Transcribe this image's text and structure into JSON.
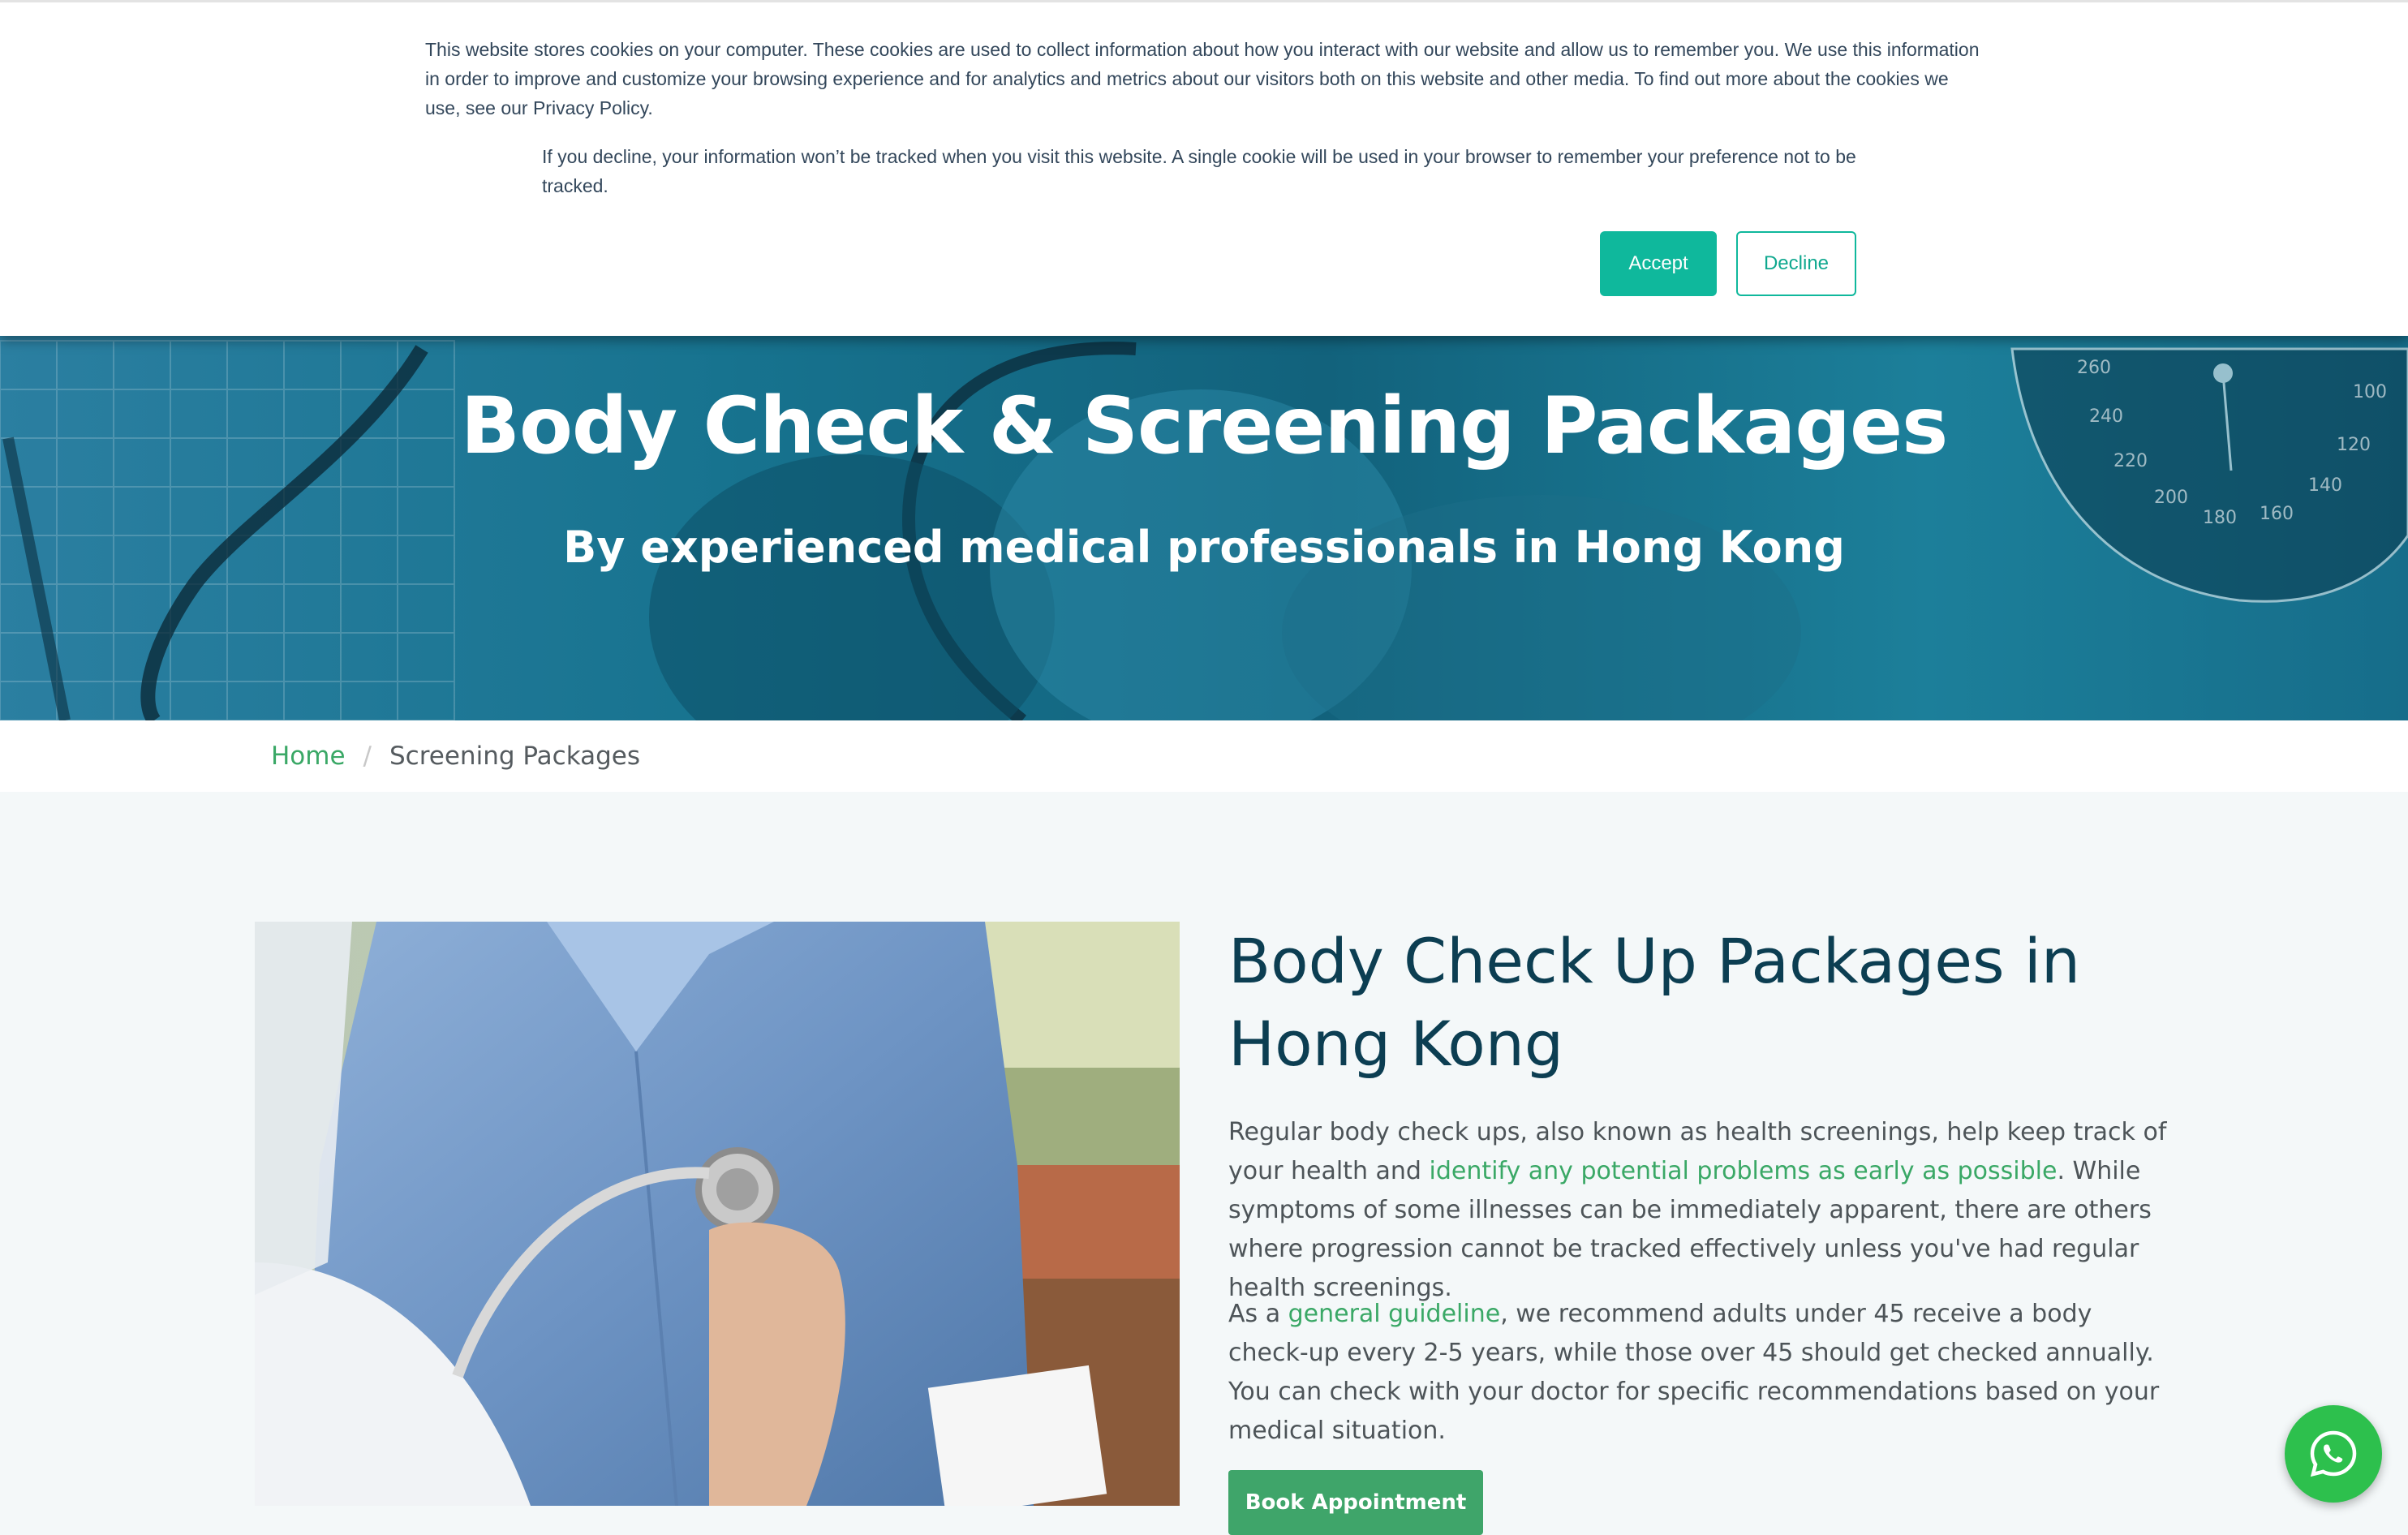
{
  "cookie_banner": {
    "text_primary": "This website stores cookies on your computer. These cookies are used to collect information about how you interact with our website and allow us to remember you. We use this information in order to improve and customize your browsing experience and for analytics and metrics about our visitors both on this website and other media. To find out more about the cookies we use, see our Privacy Policy.",
    "text_secondary": "If you decline, your information won’t be tracked when you visit this website. A single cookie will be used in your browser to remember your preference not to be tracked.",
    "accept_label": "Accept",
    "decline_label": "Decline"
  },
  "hero": {
    "title": "Body Check & Screening Packages",
    "subtitle": "By experienced medical professionals in Hong Kong",
    "gauge_numbers": [
      "260",
      "240",
      "220",
      "200",
      "180",
      "160",
      "140",
      "120",
      "100"
    ]
  },
  "breadcrumb": {
    "home": "Home",
    "separator": "/",
    "current": "Screening Packages"
  },
  "content": {
    "title": "Body Check Up Packages in Hong Kong",
    "para1_a": "Regular body check ups, also known as health screenings, help keep track of your health and ",
    "para1_link": "identify any potential problems as early as possible",
    "para1_b": ". While symptoms of some illnesses can be immediately apparent, there are others where progression cannot be tracked effectively unless you've had regular health screenings.",
    "para2_a": "As a ",
    "para2_link": "general guideline",
    "para2_b": ", we recommend adults under 45 receive a body check-up every 2-5 years, while those over 45 should get checked annually. You can check with your doctor for specific recommendations based on your medical situation.",
    "book_label": "Book Appointment"
  },
  "icons": {
    "whatsapp": "whatsapp-icon",
    "doctor_photo": "stethoscope-photo"
  },
  "colors": {
    "accent_teal": "#0fb89c",
    "brand_green": "#3fa56a",
    "link_green": "#3aa866",
    "heading_navy": "#0c3e52",
    "hero_blue": "#17738f",
    "whatsapp_green": "#2dc04d"
  }
}
